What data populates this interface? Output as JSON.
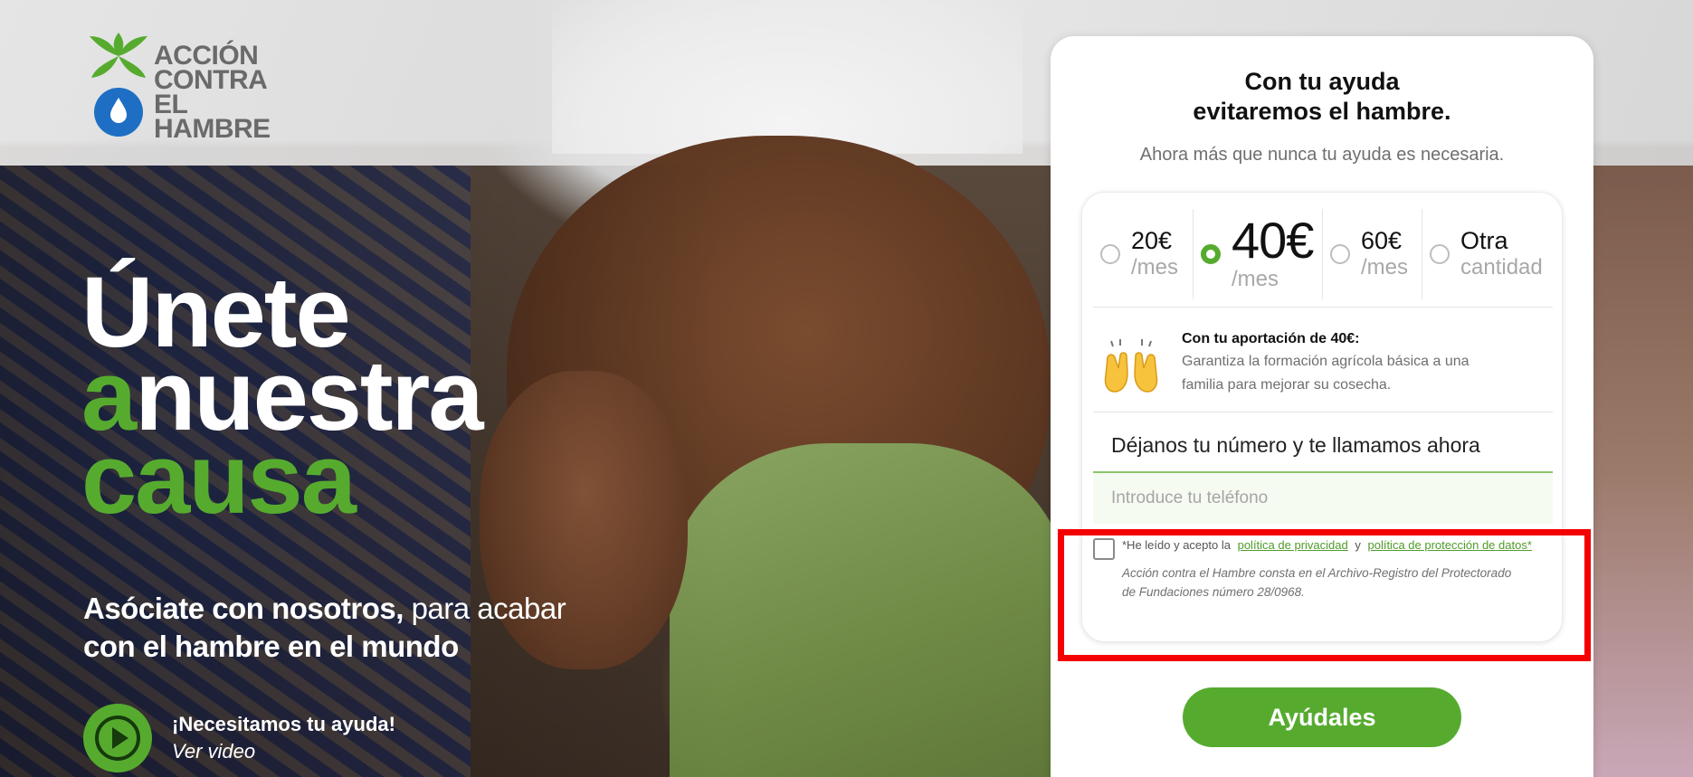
{
  "brand": {
    "name_lines": [
      "ACCIÓN",
      "CONTRA EL",
      "HAMBRE"
    ],
    "green": "#56ab2f",
    "blue": "#1e6fc4"
  },
  "hero": {
    "headline": {
      "line1": "Únete",
      "line2_green": "a",
      "line2_white": "nuestra",
      "line3": "causa"
    },
    "subtitle": {
      "bold": "Asóciate con nosotros,",
      "light": " para acabar",
      "bold2": "con el hambre en el mundo"
    },
    "video": {
      "title": "¡Necesitamos tu ayuda!",
      "link": "Ver video",
      "icon": "play-icon"
    }
  },
  "form": {
    "title_line1": "Con tu ayuda",
    "title_line2": "evitaremos el hambre.",
    "subtitle": "Ahora más que nunca tu ayuda es necesaria.",
    "amounts": [
      {
        "price": "20€",
        "per": "/mes",
        "selected": false
      },
      {
        "price": "40€",
        "per": "/mes",
        "selected": true
      },
      {
        "price": "60€",
        "per": "/mes",
        "selected": false
      },
      {
        "price": "Otra",
        "per": "cantidad",
        "selected": false
      }
    ],
    "impact": {
      "icon": "raised-hands-icon",
      "heading": "Con tu aportación de 40€:",
      "description_line1": "Garantiza la formación agrícola básica a una",
      "description_line2": "familia para mejorar su cosecha."
    },
    "phone": {
      "label": "Déjanos tu número y te llamamos ahora",
      "placeholder": "Introduce tu teléfono"
    },
    "consent": {
      "prefix": "*He leído y acepto la",
      "privacy_link": "política de privacidad",
      "and": "y",
      "data_link": "política de protección de datos*",
      "note_line1": "Acción contra el Hambre consta en el Archivo-Registro del Protectorado",
      "note_line2": "de Fundaciones número 28/0968."
    },
    "cta": "Ayúdales"
  }
}
